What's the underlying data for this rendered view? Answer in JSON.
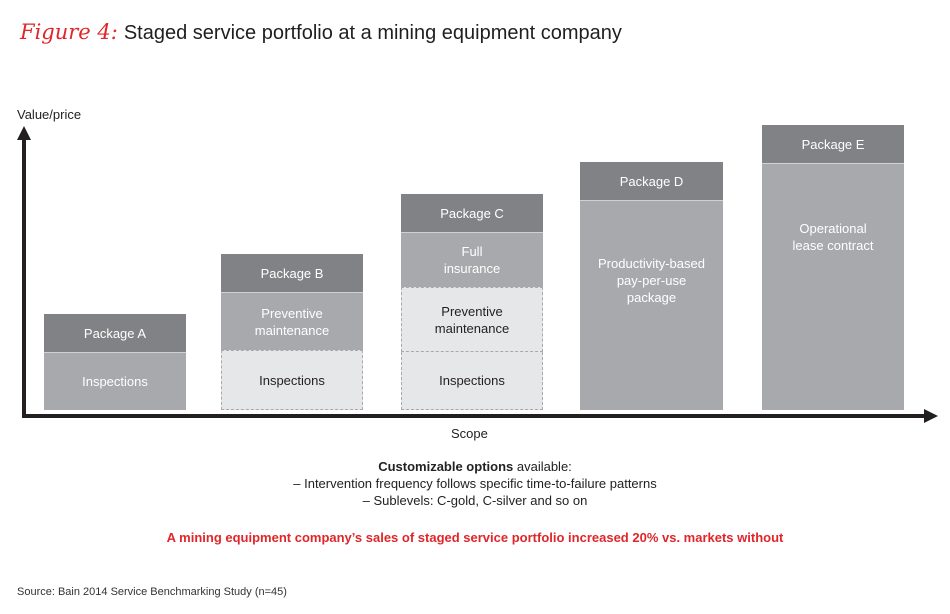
{
  "figure": {
    "label": "Figure 4:",
    "title": "Staged service portfolio at a mining equipment company"
  },
  "axes": {
    "y_label": "Value/price",
    "x_label": "Scope"
  },
  "colors": {
    "accent_red": "#e0262a",
    "header_gray": "#808285",
    "included_gray": "#a7a9ac",
    "inherited_light": "#e6e7e8",
    "axis": "#231f20"
  },
  "packages": [
    {
      "name": "Package A",
      "segments": [
        {
          "label": "Inspections",
          "style": "solid"
        }
      ]
    },
    {
      "name": "Package B",
      "segments": [
        {
          "label": "Preventive maintenance",
          "style": "solid"
        },
        {
          "label": "Inspections",
          "style": "dashed"
        }
      ]
    },
    {
      "name": "Package C",
      "segments": [
        {
          "label": "Full insurance",
          "style": "solid"
        },
        {
          "label": "Preventive maintenance",
          "style": "dashed"
        },
        {
          "label": "Inspections",
          "style": "dashed"
        }
      ]
    },
    {
      "name": "Package D",
      "segments": [
        {
          "label": "Productivity-based pay-per-use package",
          "style": "solid"
        }
      ]
    },
    {
      "name": "Package E",
      "segments": [
        {
          "label": "Operational lease contract",
          "style": "solid"
        }
      ]
    }
  ],
  "notes": {
    "heading_bold": "Customizable options",
    "heading_rest": " available:",
    "items": [
      "– Intervention frequency follows specific time-to-failure patterns",
      "– Sublevels: C-gold, C-silver and so on"
    ]
  },
  "highlight": "A mining equipment company’s sales of staged service portfolio increased 20% vs. markets without",
  "source": "Source: Bain 2014 Service Benchmarking Study (n=45)"
}
